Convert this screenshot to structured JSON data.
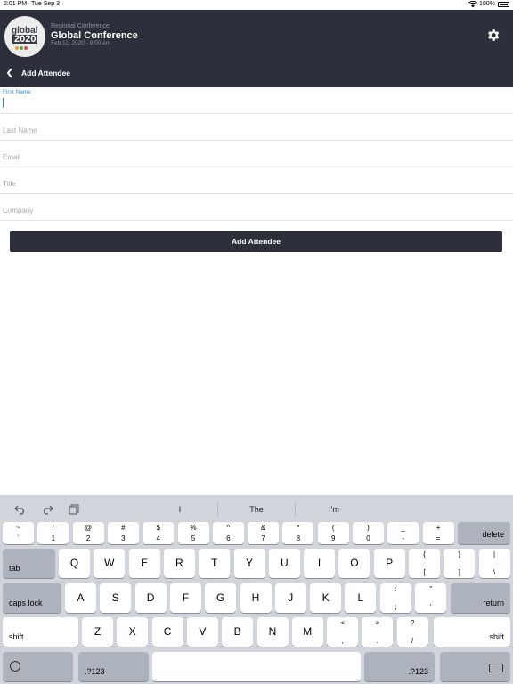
{
  "status_bar": {
    "time": "2:01 PM",
    "date": "Tue Sep 3",
    "battery": "100%"
  },
  "header": {
    "logo_line1": "global",
    "logo_line2": "2020",
    "subtitle": "Regional Conference",
    "title": "Global Conference",
    "date": "Feb 11, 2020 - 8:00 am",
    "page_title": "Add Attendee"
  },
  "form": {
    "fields": [
      {
        "label": "First Name"
      },
      {
        "label": "Last Name"
      },
      {
        "label": "Email"
      },
      {
        "label": "Title"
      },
      {
        "label": "Company"
      }
    ],
    "submit_label": "Add Attendee"
  },
  "keyboard": {
    "suggestions": [
      "I",
      "The",
      "I'm"
    ],
    "number_row": [
      {
        "top": "~",
        "bottom": "`"
      },
      {
        "top": "!",
        "bottom": "1"
      },
      {
        "top": "@",
        "bottom": "2"
      },
      {
        "top": "#",
        "bottom": "3"
      },
      {
        "top": "$",
        "bottom": "4"
      },
      {
        "top": "%",
        "bottom": "5"
      },
      {
        "top": "^",
        "bottom": "6"
      },
      {
        "top": "&",
        "bottom": "7"
      },
      {
        "top": "*",
        "bottom": "8"
      },
      {
        "top": "(",
        "bottom": "9"
      },
      {
        "top": ")",
        "bottom": "0"
      },
      {
        "top": "_",
        "bottom": "-"
      },
      {
        "top": "+",
        "bottom": "="
      }
    ],
    "delete_label": "delete",
    "row1": [
      "Q",
      "W",
      "E",
      "R",
      "T",
      "Y",
      "U",
      "I",
      "O",
      "P"
    ],
    "row1_symbols": [
      {
        "top": "{",
        "bottom": "["
      },
      {
        "top": "}",
        "bottom": "]"
      },
      {
        "top": "|",
        "bottom": "\\"
      }
    ],
    "tab_label": "tab",
    "row2": [
      "A",
      "S",
      "D",
      "F",
      "G",
      "H",
      "J",
      "K",
      "L"
    ],
    "row2_symbols": [
      {
        "top": ":",
        "bottom": ";"
      },
      {
        "top": "\"",
        "bottom": "'"
      }
    ],
    "caps_label": "caps lock",
    "return_label": "return",
    "row3": [
      "Z",
      "X",
      "C",
      "V",
      "B",
      "N",
      "M"
    ],
    "row3_symbols": [
      {
        "top": "<",
        "bottom": ","
      },
      {
        "top": ">",
        "bottom": "."
      },
      {
        "top": "?",
        "bottom": "/"
      }
    ],
    "shift_label": "shift",
    "numbers_label": ".?123",
    "space_label": "",
    "accent_color": "#2a8bdc"
  }
}
